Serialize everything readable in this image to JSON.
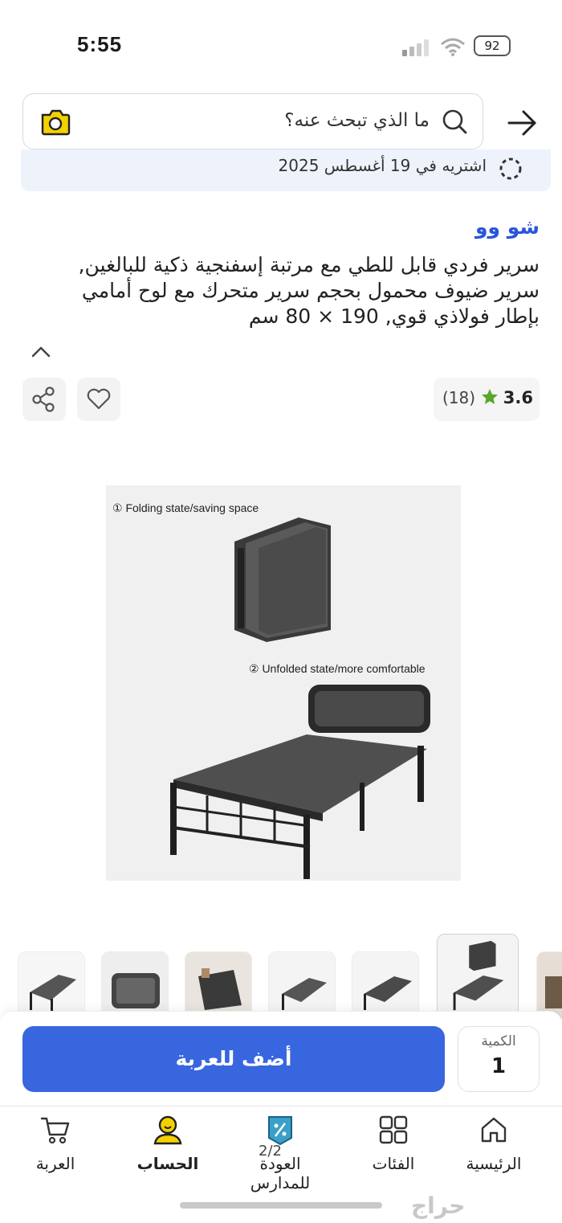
{
  "status_bar": {
    "time": "5:55",
    "battery": "92"
  },
  "search": {
    "placeholder": "ما الذي تبحث عنه؟"
  },
  "delivery": {
    "text": "اشتريه في 19 أغسطس 2025"
  },
  "product": {
    "brand": "شو وو",
    "title": "سرير فردي قابل للطي مع مرتبة إسفنجية ذكية للبالغين, سرير ضيوف محمول بحجم سرير متحرك مع لوح أمامي بإطار فولاذي قوي, 190 × 80 سم",
    "rating": "3.6",
    "review_count": "(18)"
  },
  "image": {
    "caption_folded": "① Folding state/saving space",
    "caption_unfolded": "② Unfolded state/more comfortable"
  },
  "cart": {
    "add_label": "أضف للعربة",
    "qty_label": "الكمية",
    "qty_value": "1"
  },
  "nav": {
    "items": [
      {
        "label": "الرئيسية",
        "icon": "home-icon"
      },
      {
        "label": "الفئات",
        "icon": "grid-icon"
      },
      {
        "label": "العودة للمدارس",
        "icon": "discount-tag-icon"
      },
      {
        "label": "الحساب",
        "icon": "account-icon"
      },
      {
        "label": "العربة",
        "icon": "cart-icon"
      }
    ]
  },
  "page_indicator": "2/2",
  "watermark": "حراج",
  "colors": {
    "accent": "#3866df",
    "brand": "#2a56d8",
    "star": "#5aa62b",
    "account": "#f4d000"
  }
}
